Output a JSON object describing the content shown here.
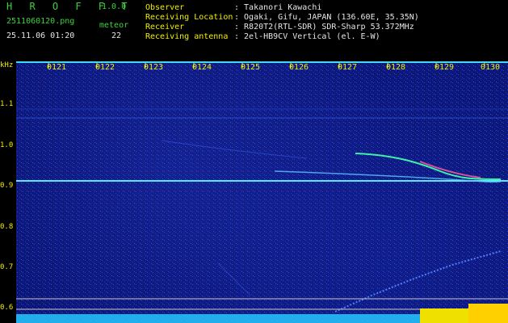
{
  "app": {
    "name": "H R O F F T",
    "version": "1.0.0"
  },
  "file": {
    "name": "2511060120.png",
    "timestamp": "25.11.06 01:20"
  },
  "meteor": {
    "label": "meteor",
    "count": "22"
  },
  "info": {
    "observer_label": "Observer",
    "observer_value": ": Takanori Kawachi",
    "location_label": "Receiving Location",
    "location_value": ": Ogaki, Gifu, JAPAN (136.60E, 35.35N)",
    "receiver_label": "Receiver",
    "receiver_value": ": R820T2(RTL-SDR) SDR-Sharp 53.372MHz",
    "antenna_label": "Receiving antenna",
    "antenna_value": ": 2el-HB9CV Vertical (el. E-W)"
  },
  "axes": {
    "y_unit": "kHz",
    "y_ticks": [
      "1.1",
      "1.0",
      "0.9",
      "0.8",
      "0.7",
      "0.6"
    ],
    "x_ticks": [
      "0121",
      "0122",
      "0123",
      "0124",
      "0125",
      "0126",
      "0127",
      "0128",
      "0129",
      "0130"
    ]
  },
  "colors": {
    "header_green": "#3bd23b",
    "header_yellow": "#f0f000",
    "background": "#0a1470"
  }
}
